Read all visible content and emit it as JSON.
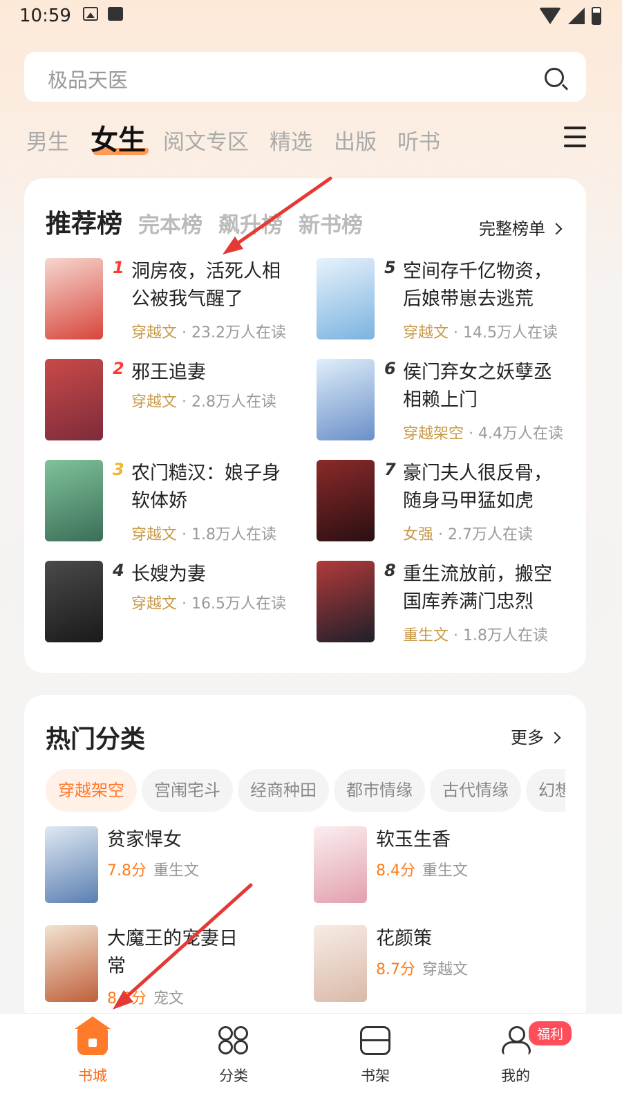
{
  "status_bar": {
    "time": "10:59"
  },
  "search": {
    "placeholder": "极品天医"
  },
  "channel_tabs": [
    "男生",
    "女生",
    "阅文专区",
    "精选",
    "出版",
    "听书"
  ],
  "ranking": {
    "tabs": [
      "推荐榜",
      "完本榜",
      "飙升榜",
      "新书榜"
    ],
    "more_label": "完整榜单",
    "books": [
      {
        "rank": "1",
        "title": "洞房夜，活死人相公被我气醒了",
        "genre": "穿越文",
        "readers": " · 23.2万人在读",
        "rank_color": "#ff3b30",
        "cover": [
          "#f6d7cf",
          "#d7463c"
        ]
      },
      {
        "rank": "2",
        "title": "邪王追妻",
        "genre": "穿越文",
        "readers": " · 2.8万人在读",
        "rank_color": "#ff3b30",
        "cover": [
          "#c94a48",
          "#7d2b3a"
        ]
      },
      {
        "rank": "3",
        "title": "农门糙汉：娘子身软体娇",
        "genre": "穿越文",
        "readers": " · 1.8万人在读",
        "rank_color": "#f2b233",
        "cover": [
          "#7fc39a",
          "#3b6e58"
        ]
      },
      {
        "rank": "4",
        "title": "长嫂为妻",
        "genre": "穿越文",
        "readers": " · 16.5万人在读",
        "rank_color": "#333333",
        "cover": [
          "#4a4a4a",
          "#1a1a1a"
        ]
      },
      {
        "rank": "5",
        "title": "空间存千亿物资，后娘带崽去逃荒",
        "genre": "穿越文",
        "readers": " · 14.5万人在读",
        "rank_color": "#333333",
        "cover": [
          "#e7f2fb",
          "#7bb3e0"
        ]
      },
      {
        "rank": "6",
        "title": "侯门弃女之妖孽丞相赖上门",
        "genre": "穿越架空",
        "readers": " · 4.4万人在读",
        "rank_color": "#333333",
        "cover": [
          "#dfeefa",
          "#6a8fc8"
        ]
      },
      {
        "rank": "7",
        "title": "豪门夫人很反骨，随身马甲猛如虎",
        "genre": "女强",
        "readers": " · 2.7万人在读",
        "rank_color": "#333333",
        "cover": [
          "#8b2a2a",
          "#2a0f12"
        ]
      },
      {
        "rank": "8",
        "title": "重生流放前，搬空国库养满门忠烈",
        "genre": "重生文",
        "readers": " · 1.8万人在读",
        "rank_color": "#333333",
        "cover": [
          "#b23a3a",
          "#1f1f2a"
        ]
      }
    ]
  },
  "categories": {
    "title": "热门分类",
    "more_label": "更多",
    "chips": [
      "穿越架空",
      "宫闱宅斗",
      "经商种田",
      "都市情缘",
      "古代情缘",
      "幻想"
    ],
    "books": [
      {
        "title": "贫家悍女",
        "score": "7.8分",
        "genre": "重生文",
        "cover": [
          "#dfe8f3",
          "#5b7fb1"
        ]
      },
      {
        "title": "软玉生香",
        "score": "8.4分",
        "genre": "重生文",
        "cover": [
          "#fbeef0",
          "#e2a0ad"
        ]
      },
      {
        "title": "大魔王的宠妻日常",
        "score": "8.6分",
        "genre": "宠文",
        "cover": [
          "#f1e3d2",
          "#c0603a"
        ]
      },
      {
        "title": "花颜策",
        "score": "8.7分",
        "genre": "穿越文",
        "cover": [
          "#f7ece6",
          "#d9b9a8"
        ]
      }
    ]
  },
  "bottom_nav": {
    "items": [
      "书城",
      "分类",
      "书架",
      "我的"
    ],
    "badge": "福利"
  },
  "colors": {
    "accent": "#ff7a2a",
    "rank_red": "#ff3b30",
    "genre_gold": "#c89a4a",
    "score_orange": "#ff7a1a",
    "annotation_arrow": "#e53935"
  }
}
